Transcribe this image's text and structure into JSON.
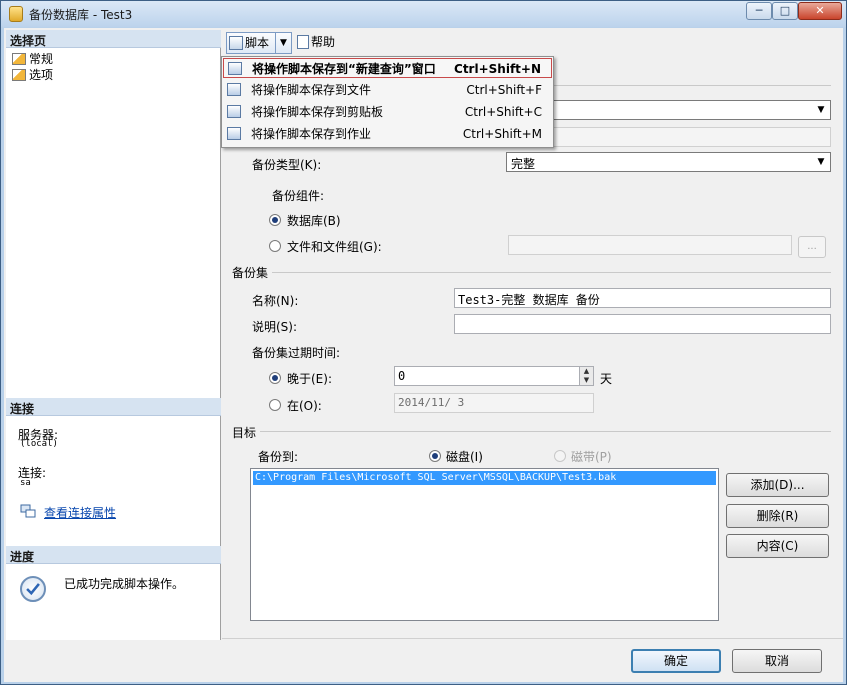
{
  "window": {
    "title": "备份数据库 - Test3",
    "min": "─",
    "max": "□",
    "close": "✕"
  },
  "left": {
    "select_page_header": "选择页",
    "pages": [
      "常规",
      "选项"
    ],
    "connection_header": "连接",
    "server_label": "服务器:",
    "server_value": "(local)",
    "connection_label": "连接:",
    "connection_value": "sa",
    "view_props_link": "查看连接属性",
    "progress_header": "进度",
    "progress_text": "已成功完成脚本操作。"
  },
  "toolbar": {
    "script_label": "脚本",
    "dropdown_glyph": "▼",
    "help_label": "帮助"
  },
  "script_menu": {
    "items": [
      {
        "label": "将操作脚本保存到“新建查询”窗口",
        "shortcut": "Ctrl+Shift+N"
      },
      {
        "label": "将操作脚本保存到文件",
        "shortcut": "Ctrl+Shift+F"
      },
      {
        "label": "将操作脚本保存到剪贴板",
        "shortcut": "Ctrl+Shift+C"
      },
      {
        "label": "将操作脚本保存到作业",
        "shortcut": "Ctrl+Shift+M"
      }
    ]
  },
  "source": {
    "backup_type_label": "备份类型(K):",
    "backup_type_value": "完整",
    "component_label": "备份组件:",
    "radio_database": "数据库(B)",
    "radio_files": "文件和文件组(G):",
    "ellipsis": "..."
  },
  "backup_set": {
    "title": "备份集",
    "name_label": "名称(N):",
    "name_value": "Test3-完整 数据库 备份",
    "desc_label": "说明(S):",
    "desc_value": "",
    "expire_label": "备份集过期时间:",
    "after_label": "晚于(E):",
    "after_value": "0",
    "after_unit": "天",
    "on_label": "在(O):",
    "on_value": "2014/11/ 3"
  },
  "destination": {
    "title": "目标",
    "backup_to_label": "备份到:",
    "disk_label": "磁盘(I)",
    "tape_label": "磁带(P)",
    "paths": [
      "C:\\Program Files\\Microsoft SQL Server\\MSSQL\\BACKUP\\Test3.bak"
    ],
    "add_button": "添加(D)...",
    "remove_button": "删除(R)",
    "contents_button": "内容(C)"
  },
  "footer": {
    "ok_button": "确定",
    "cancel_button": "取消"
  },
  "colors": {
    "highlight_border": "#c84a4a",
    "selection_bg": "#3399ff",
    "link": "#0645ad"
  }
}
